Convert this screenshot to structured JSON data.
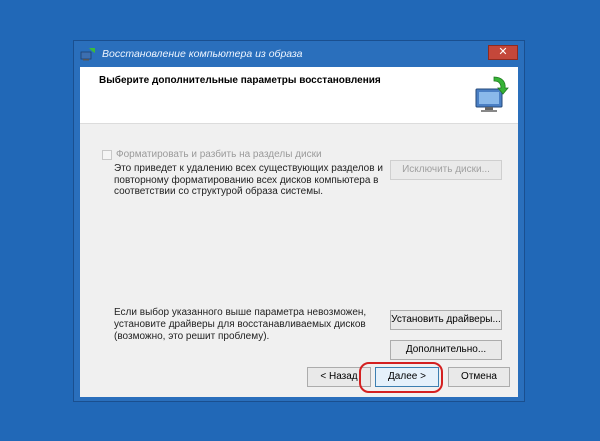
{
  "window": {
    "title": "Восстановление компьютера из образа",
    "close_symbol": "✕"
  },
  "header": {
    "title": "Выберите дополнительные параметры восстановления",
    "icon": "restore-computer-icon"
  },
  "options": {
    "format_checkbox": {
      "label": "Форматировать и разбить на разделы диски",
      "checked": false,
      "enabled": false
    },
    "format_description": "Это приведет к удалению всех существующих разделов и повторному форматированию всех дисков компьютера в соответствии со структурой образа системы.",
    "exclude_disks_label": "Исключить диски...",
    "driver_note": "Если выбор указанного выше параметра невозможен, установите драйверы для восстанавливаемых дисков (возможно, это решит проблему).",
    "install_drivers_label": "Установить драйверы...",
    "advanced_label": "Дополнительно..."
  },
  "footer": {
    "back_label": "< Назад",
    "next_label": "Далее >",
    "cancel_label": "Отмена"
  },
  "colors": {
    "desktop": "#2168b7",
    "highlight": "#d42020"
  }
}
